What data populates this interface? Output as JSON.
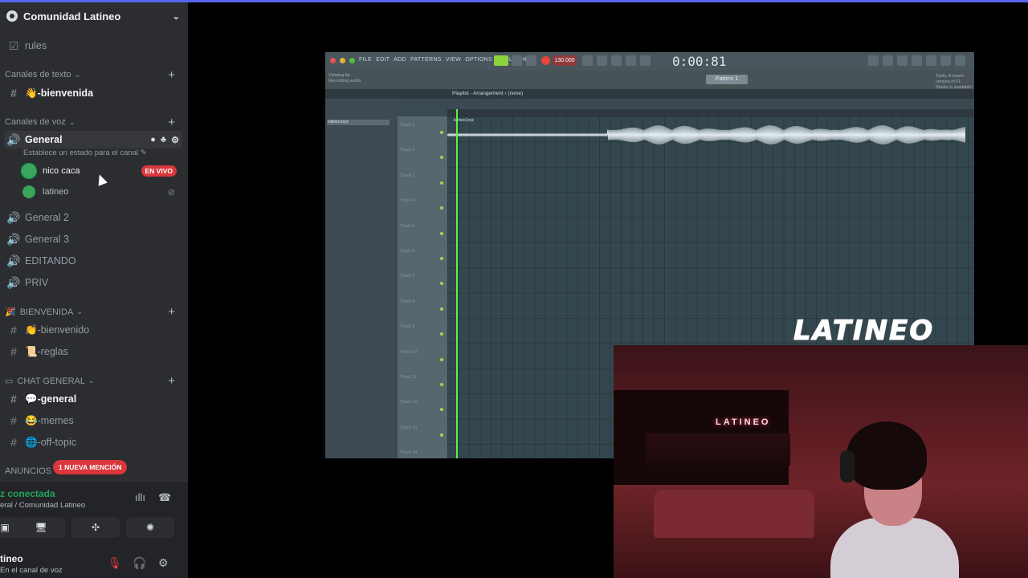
{
  "server": {
    "name": "Comunidad Latineo"
  },
  "channels": {
    "rules": "rules",
    "text_category": "Canales de texto",
    "bienvenida": "👋-bienvenida",
    "voice_category": "Canales de voz",
    "general": "General",
    "general_status": "Establece un estado para el canal",
    "voice_users": [
      {
        "name": "nico caca",
        "badge": "EN VIVO"
      },
      {
        "name": "latineo"
      }
    ],
    "general2": "General 2",
    "general3": "General 3",
    "editando": "EDITANDO",
    "priv": "PRIV",
    "bienvenida_category": "BIENVENIDA",
    "bienvenido": "👏-bienvenido",
    "reglas": "📜-reglas",
    "chat_category": "CHAT GENERAL",
    "general_text": "💬-general",
    "memes": "😂-memes",
    "offtopic": "🌐-off-topic",
    "anuncios_category": "ANUNCIOS",
    "mention_pill": "1 NUEVA MENCIÓN"
  },
  "voice_panel": {
    "title": "z conectada",
    "subtitle": "eral / Comunidad Latineo"
  },
  "user_panel": {
    "name": "tineo",
    "status": "En el canal de voz"
  },
  "daw": {
    "menu": "FILE EDIT ADD PATTERNS VIEW OPTIONS TOOLS HELP",
    "time": "0:00:81",
    "bpm": "130.000",
    "pattern": "Pattern 1",
    "info_line1": "Viewing.flp",
    "info_line2": "Recording audio",
    "hint": "Tools: A newer version of FL Studio is available!",
    "playlist_title": "Playlist - Arrangement › (none)",
    "browser_selected": "latineo1xyz",
    "tracks": [
      "Track 1",
      "Track 2",
      "Track 3",
      "Track 4",
      "Track 5",
      "Track 6",
      "Track 7",
      "Track 8",
      "Track 9",
      "Track 10",
      "Track 11",
      "Track 12",
      "Track 13",
      "Track 14"
    ],
    "clip_name": "latineo1xyz"
  },
  "brand": {
    "logo": "LATINEO",
    "neon_sign": "LATINEO"
  },
  "colors": {
    "accent": "#5865f2",
    "live": "#da373c",
    "connected": "#23a559",
    "playhead": "#5ef53d"
  }
}
